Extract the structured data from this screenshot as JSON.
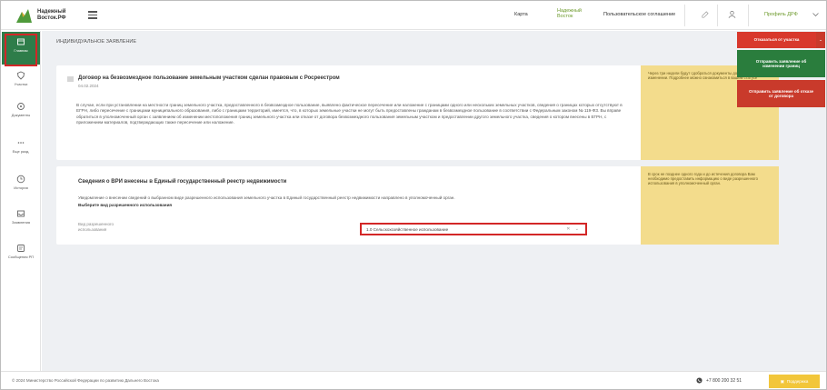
{
  "header": {
    "logo_line1": "Надежный",
    "logo_line2": "Восток.РФ",
    "links": [
      "Карта",
      "Надежный Восток",
      "Пользовательское соглашение"
    ],
    "user_label": "Профиль ДРФ"
  },
  "sidebar": {
    "items": [
      {
        "label": "Главная"
      },
      {
        "label": "Участки"
      },
      {
        "label": "Документы"
      },
      {
        "label": "Еще разд."
      },
      {
        "label": "История"
      },
      {
        "label": "Заявления"
      },
      {
        "label": "Сообщения РП"
      }
    ]
  },
  "page": {
    "title": "ИНДИВИДУАЛЬНОЕ ЗАЯВЛЕНИЕ"
  },
  "card1": {
    "title": "Договор на безвозмездное пользование земельным участком сделан правовым с Росреестром",
    "date": "04.02.2024",
    "text": "В случае, если при установлении на местности границ земельного участка, предоставленного в безвозмездное пользование, выявлено фактическое пересечение или наложение с границами одного или нескольких земельных участков, сведения о границах которых отсутствуют в ЕГРН, либо пересечение с границами муниципального образования, либо с границами территорий, имеется, что, в которых земельные участки не могут быть предоставлены гражданам в безвозмездное пользование в соответствии с Федеральным законом № 119-ФЗ. Вы вправе обратиться в уполномоченный орган с заявлением об изменении местоположения границ земельного участка или отказе от договора безвозмездного пользования земельным участком и предоставлении другого земельного участка, сведения о котором внесены в ЕГРН, с приложением материалов, подтверждающих также пересечение или наложение.",
    "note": "Через три недели будут сдобраться документы документов об изменении. Подробнее можно ознакомиться в вашем статусе",
    "note_link": "в вашем статусе"
  },
  "card2": {
    "title": "Сведения о ВРИ внесены в Единый государственный реестр недвижимости",
    "text": "Уведомление о внесении сведений о выбранном виде разрешенного использования земельного участка в Единый государственный реестр недвижимости направлено в уполномоченный орган.",
    "bold": "Выберите вид разрешенного использования",
    "field_label": "Вид разрешенного использования",
    "select_value": "1.0 Сельскохозяйственное использование",
    "note": "В срок не позднее одного года и до истечения договора Вам необходимо предоставить информацию о виде разрешенного использования в уполномоченный орган."
  },
  "actions": {
    "primary": "Отказаться от участка",
    "secondary": "Отправить заявление об изменении границ",
    "tertiary": "Отправить заявление об отказе от договора"
  },
  "footer": {
    "copyright": "© 2024 Министерство Российской Федерации по развитию Дальнего Востока",
    "phone": "+7 800 200 32 51",
    "button": "Поддержка"
  },
  "colors": {
    "brand_green": "#2e7d4a",
    "accent_red": "#d32727",
    "note_yellow": "#f3dc8c",
    "footer_yellow": "#f2c63a"
  }
}
